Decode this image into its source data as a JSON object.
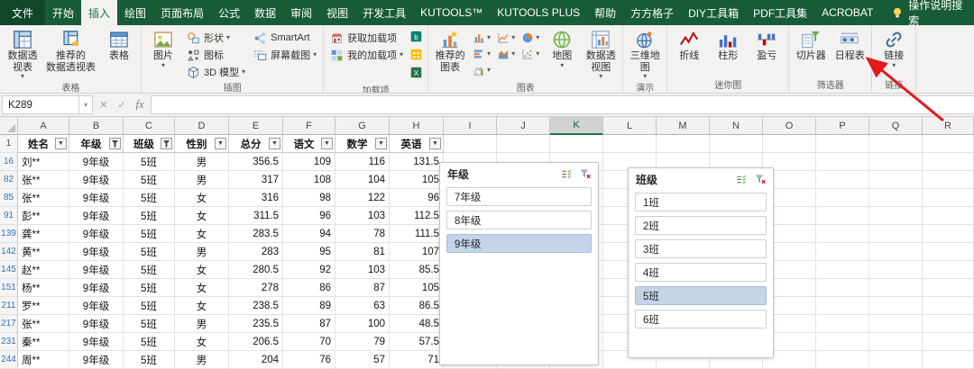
{
  "ribbon": {
    "tabs": [
      {
        "label": "文件",
        "name": "file",
        "file": true
      },
      {
        "label": "开始",
        "name": "home"
      },
      {
        "label": "插入",
        "name": "insert",
        "active": true
      },
      {
        "label": "绘图",
        "name": "draw"
      },
      {
        "label": "页面布局",
        "name": "page-layout"
      },
      {
        "label": "公式",
        "name": "formulas"
      },
      {
        "label": "数据",
        "name": "data"
      },
      {
        "label": "审阅",
        "name": "review"
      },
      {
        "label": "视图",
        "name": "view"
      },
      {
        "label": "开发工具",
        "name": "developer"
      },
      {
        "label": "KUTOOLS™",
        "name": "kutools"
      },
      {
        "label": "KUTOOLS PLUS",
        "name": "kutools-plus"
      },
      {
        "label": "帮助",
        "name": "help"
      },
      {
        "label": "方方格子",
        "name": "fangfanggezi"
      },
      {
        "label": "DIY工具箱",
        "name": "diy-toolbox"
      },
      {
        "label": "PDF工具集",
        "name": "pdf-tools"
      },
      {
        "label": "ACROBAT",
        "name": "acrobat"
      }
    ],
    "search_label": "操作说明搜索",
    "groups": [
      {
        "label": "表格",
        "name": "tables",
        "buttons": [
          {
            "type": "large",
            "name": "pivot-table",
            "icon": "pivot",
            "lines": [
              "数据透",
              "视表"
            ],
            "dropdown": true
          },
          {
            "type": "large",
            "name": "recommended-pivottables",
            "icon": "recpivot",
            "lines": [
              "推荐的",
              "数据透视表"
            ]
          },
          {
            "type": "large",
            "name": "table",
            "icon": "table",
            "lines": [
              "表格"
            ]
          }
        ]
      },
      {
        "label": "插图",
        "name": "illustrations",
        "buttons": [
          {
            "type": "large",
            "name": "pictures",
            "icon": "picture",
            "lines": [
              "图片"
            ],
            "dropdown": true
          },
          {
            "type": "stack",
            "items": [
              {
                "name": "shapes",
                "icon": "shapes",
                "label": "形状",
                "dropdown": true
              },
              {
                "name": "icons",
                "icon": "icons",
                "label": "图标"
              },
              {
                "name": "3d-models",
                "icon": "model3d",
                "label": "3D 模型",
                "dropdown": true
              }
            ]
          },
          {
            "type": "stack",
            "items": [
              {
                "name": "smartart",
                "icon": "smartart",
                "label": "SmartArt"
              },
              {
                "name": "screenshot",
                "icon": "screenshot",
                "label": "屏幕截图",
                "dropdown": true
              }
            ]
          }
        ]
      },
      {
        "label": "加载项",
        "name": "add-ins",
        "buttons": [
          {
            "type": "stack",
            "items": [
              {
                "name": "get-add-ins",
                "icon": "getaddin",
                "label": "获取加载项"
              },
              {
                "name": "my-add-ins",
                "icon": "myaddin",
                "label": "我的加载项",
                "dropdown": true
              }
            ]
          },
          {
            "type": "iconstack",
            "items": [
              {
                "name": "bing-maps-addin",
                "icon": "bing"
              },
              {
                "name": "people-graph-addin",
                "icon": "people"
              },
              {
                "name": "excel-addin",
                "icon": "sheeticon"
              }
            ]
          }
        ]
      },
      {
        "label": "图表",
        "name": "charts",
        "buttons": [
          {
            "type": "large",
            "name": "recommended-charts",
            "icon": "recchart",
            "lines": [
              "推荐的",
              "图表"
            ]
          },
          {
            "type": "chartgrid",
            "rows": [
              [
                {
                  "name": "insert-column-chart",
                  "icon": "chart_col"
                },
                {
                  "name": "insert-line-chart",
                  "icon": "chart_line"
                },
                {
                  "name": "insert-pie-chart",
                  "icon": "chart_pie"
                }
              ],
              [
                {
                  "name": "insert-bar-chart",
                  "icon": "chart_bar"
                },
                {
                  "name": "insert-area-chart",
                  "icon": "chart_area"
                },
                {
                  "name": "insert-scatter-chart",
                  "icon": "chart_scatter"
                }
              ],
              [
                {
                  "name": "insert-combo-chart",
                  "icon": "chart_other"
                }
              ]
            ]
          },
          {
            "type": "large",
            "name": "maps",
            "icon": "map",
            "lines": [
              "地图"
            ],
            "dropdown": true
          },
          {
            "type": "large",
            "name": "pivotchart",
            "icon": "pivotchart",
            "lines": [
              "数据透",
              "视图"
            ],
            "dropdown": true
          }
        ]
      },
      {
        "label": "演示",
        "name": "tours",
        "buttons": [
          {
            "type": "large",
            "name": "3d-map",
            "icon": "map3d",
            "lines": [
              "三维地",
              "图"
            ],
            "dropdown": true
          }
        ]
      },
      {
        "label": "迷你图",
        "name": "sparklines",
        "buttons": [
          {
            "type": "large",
            "name": "sparkline-line",
            "icon": "spark_line",
            "lines": [
              "折线"
            ]
          },
          {
            "type": "large",
            "name": "sparkline-column",
            "icon": "spark_col",
            "lines": [
              "柱形"
            ]
          },
          {
            "type": "large",
            "name": "sparkline-winloss",
            "icon": "spark_wl",
            "lines": [
              "盈亏"
            ]
          }
        ]
      },
      {
        "label": "筛选器",
        "name": "filters",
        "buttons": [
          {
            "type": "large",
            "name": "slicer",
            "icon": "slicer",
            "lines": [
              "切片器"
            ]
          },
          {
            "type": "large",
            "name": "timeline",
            "icon": "timeline",
            "lines": [
              "日程表"
            ]
          }
        ]
      },
      {
        "label": "链接",
        "name": "links",
        "buttons": [
          {
            "type": "large",
            "name": "link",
            "icon": "link",
            "lines": [
              "链接"
            ],
            "dropdown": true
          }
        ]
      }
    ]
  },
  "formula_bar": {
    "name_box": "K289",
    "fx_label": "fx"
  },
  "grid": {
    "columns": [
      "A",
      "B",
      "C",
      "D",
      "E",
      "F",
      "G",
      "H",
      "I",
      "J",
      "K",
      "L",
      "M",
      "N",
      "O",
      "P",
      "Q",
      "R"
    ],
    "selected_column": "K",
    "header_row_number": "1",
    "headers": [
      {
        "label": "姓名",
        "filter": "dropdown"
      },
      {
        "label": "年级",
        "filter": "funnel"
      },
      {
        "label": "班级",
        "filter": "funnel"
      },
      {
        "label": "性别",
        "filter": "dropdown"
      },
      {
        "label": "总分",
        "filter": "dropdown"
      },
      {
        "label": "语文",
        "filter": "dropdown"
      },
      {
        "label": "数学",
        "filter": "dropdown"
      },
      {
        "label": "英语",
        "filter": "dropdown"
      }
    ],
    "rows": [
      {
        "n": "16",
        "cells": [
          "刘**",
          "9年级",
          "5班",
          "男",
          "356.5",
          "109",
          "116",
          "131.5"
        ]
      },
      {
        "n": "82",
        "cells": [
          "张**",
          "9年级",
          "5班",
          "男",
          "317",
          "108",
          "104",
          "105"
        ]
      },
      {
        "n": "85",
        "cells": [
          "张**",
          "9年级",
          "5班",
          "女",
          "316",
          "98",
          "122",
          "96"
        ]
      },
      {
        "n": "91",
        "cells": [
          "彭**",
          "9年级",
          "5班",
          "女",
          "311.5",
          "96",
          "103",
          "112.5"
        ]
      },
      {
        "n": "139",
        "cells": [
          "龚**",
          "9年级",
          "5班",
          "女",
          "283.5",
          "94",
          "78",
          "111.5"
        ]
      },
      {
        "n": "142",
        "cells": [
          "黄**",
          "9年级",
          "5班",
          "男",
          "283",
          "95",
          "81",
          "107"
        ]
      },
      {
        "n": "145",
        "cells": [
          "赵**",
          "9年级",
          "5班",
          "女",
          "280.5",
          "92",
          "103",
          "85.5"
        ]
      },
      {
        "n": "151",
        "cells": [
          "杨**",
          "9年级",
          "5班",
          "女",
          "278",
          "86",
          "87",
          "105"
        ]
      },
      {
        "n": "211",
        "cells": [
          "罗**",
          "9年级",
          "5班",
          "女",
          "238.5",
          "89",
          "63",
          "86.5"
        ]
      },
      {
        "n": "217",
        "cells": [
          "张**",
          "9年级",
          "5班",
          "男",
          "235.5",
          "87",
          "100",
          "48.5"
        ]
      },
      {
        "n": "231",
        "cells": [
          "秦**",
          "9年级",
          "5班",
          "女",
          "206.5",
          "70",
          "79",
          "57.5"
        ]
      },
      {
        "n": "244",
        "cells": [
          "周**",
          "9年级",
          "5班",
          "男",
          "204",
          "76",
          "57",
          "71"
        ]
      }
    ]
  },
  "slicers": [
    {
      "title": "年级",
      "name": "slicer-grade",
      "items": [
        {
          "label": "7年级"
        },
        {
          "label": "8年级"
        },
        {
          "label": "9年级",
          "selected": true
        }
      ]
    },
    {
      "title": "班级",
      "name": "slicer-class",
      "items": [
        {
          "label": "1班"
        },
        {
          "label": "2班"
        },
        {
          "label": "3班"
        },
        {
          "label": "4班"
        },
        {
          "label": "5班",
          "selected": true
        },
        {
          "label": "6班"
        }
      ]
    }
  ],
  "colors": {
    "ribbon_green": "#185c37",
    "accent_green": "#217346",
    "slicer_selected": "#c4d4e9",
    "filtered_row_number": "#2f75b5",
    "annotation_arrow": "#e21b1b"
  }
}
